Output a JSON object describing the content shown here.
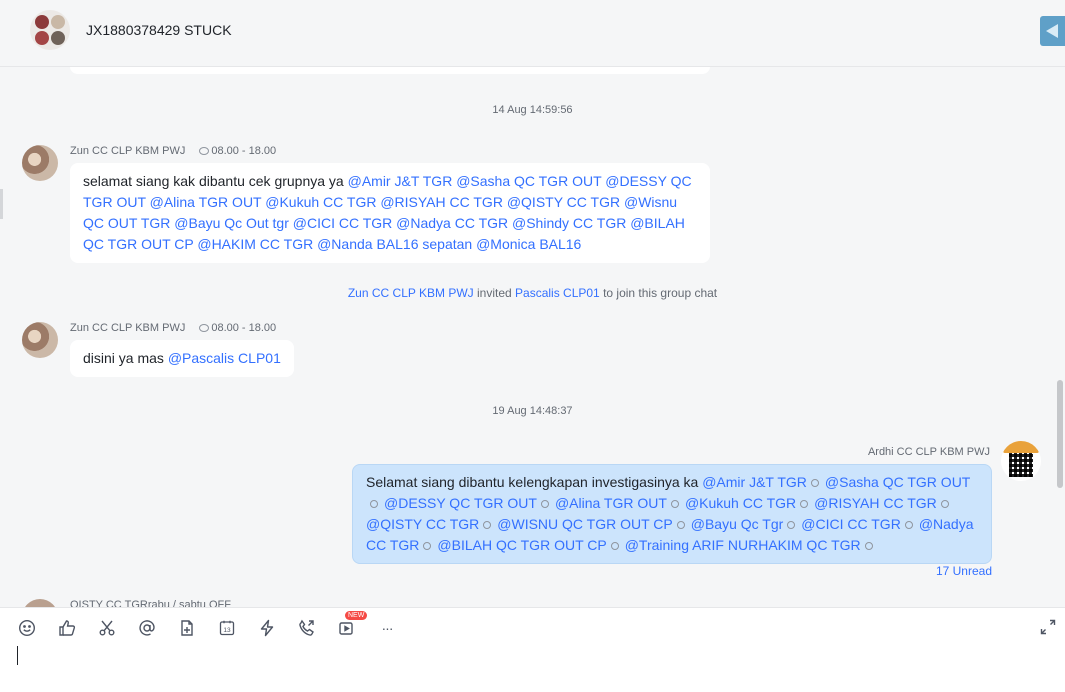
{
  "header": {
    "title": "JX1880378429 STUCK"
  },
  "timestamps": [
    "14 Aug 14:59:56",
    "19 Aug 14:48:37"
  ],
  "messages": [
    {
      "sender": "Zun CC CLP KBM PWJ",
      "status": "08.00 - 18.00",
      "text": "selamat siang kak dibantu cek grupnya ya ",
      "mentions": "@Amir J&T TGR @Sasha QC TGR OUT @DESSY QC TGR OUT @Alina TGR OUT @Kukuh CC TGR @RISYAH CC TGR @QISTY CC TGR @Wisnu QC OUT TGR @Bayu Qc Out tgr @CICI CC TGR @Nadya CC TGR @Shindy CC TGR @BILAH QC TGR OUT CP @HAKIM CC TGR @Nanda BAL16 sepatan @Monica BAL16"
    },
    {
      "sender": "Zun CC CLP KBM PWJ",
      "status": "08.00 - 18.00",
      "text": "disini ya mas ",
      "mentions": "@Pascalis CLP01"
    }
  ],
  "system": {
    "inviter": "Zun CC CLP KBM PWJ",
    "action": " invited ",
    "invitee": "Pascalis CLP01",
    "suffix": " to join this group chat"
  },
  "my_message": {
    "sender": "Ardhi CC CLP KBM PWJ",
    "text": "Selamat siang dibantu kelengkapan investigasinya ka ",
    "mentions": [
      "@Amir J&T TGR",
      "@Sasha QC TGR OUT",
      "@DESSY QC TGR OUT",
      "@Alina TGR OUT",
      "@Kukuh CC TGR",
      "@RISYAH CC TGR",
      "@QISTY CC TGR",
      "@WISNU QC TGR  OUT CP",
      "@Bayu Qc Tgr",
      "@CICI CC TGR",
      "@Nadya CC TGR",
      "@BILAH QC TGR OUT CP",
      "@Training ARIF NURHAKIM QC TGR"
    ],
    "unread": "17 Unread"
  },
  "next_message": {
    "sender": "QISTY CC TGR",
    "status": "rabu / sabtu OFF"
  },
  "composer": {
    "tools": [
      "emoji-icon",
      "thumbs-up-icon",
      "scissors-icon",
      "mention-icon",
      "doc-add-icon",
      "calendar-icon",
      "lightning-icon",
      "call-icon",
      "video-icon",
      "more-icon"
    ],
    "calendar_day": "13",
    "new_badge": "NEW",
    "more": "···"
  },
  "colors": {
    "mention": "#3370ff",
    "my_bubble": "#cce4fc",
    "unread": "#3370ff"
  }
}
